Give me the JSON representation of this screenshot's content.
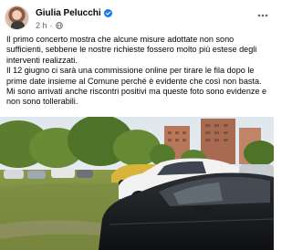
{
  "author": {
    "name": "Giulia Pelucchi",
    "verified": true,
    "time": "2 h",
    "privacy_icon": "globe-icon"
  },
  "post": {
    "paragraphs": [
      "Il primo concerto mostra che alcune misure adottate non sono sufficienti, sebbene le nostre richieste fossero molto più estese degli interventi realizzati.",
      "Il 12 giugno ci sarà una commissione online per tirare le fila dopo le prime date insieme al Comune perché è evidente che così non basta.",
      "Mi sono arrivati anche riscontri positivi ma queste foto sono evidenze e non sono tollerabili."
    ]
  },
  "icons": {
    "more": "more-options-icon",
    "verified": "verified-badge-icon"
  },
  "colors": {
    "verified": "#1877f2",
    "secondary_text": "#65676b",
    "text": "#050505"
  }
}
